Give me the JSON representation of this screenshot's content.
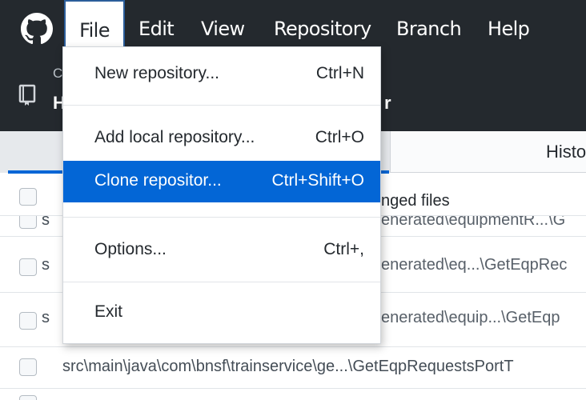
{
  "menubar": {
    "items": [
      "File",
      "Edit",
      "View",
      "Repository",
      "Branch",
      "Help"
    ]
  },
  "repo_bar": {
    "clip_1": "C",
    "clip_2": "H",
    "clip_3": "r"
  },
  "tabs": {
    "history": "Histo"
  },
  "file_list": {
    "header_right": "nged files",
    "rows": [
      {
        "left": "s",
        "right": "enerated\\equipmentR...\\G"
      },
      {
        "left": "s",
        "right": "enerated\\eq...\\GetEqpRec"
      },
      {
        "left": "s",
        "right": "enerated\\equip...\\GetEqp"
      },
      {
        "left": "src\\main\\java\\com\\bnsf\\trainservice\\ge...\\GetEqpRequestsPortT",
        "right": ""
      }
    ]
  },
  "file_menu": {
    "items": [
      {
        "label": "New repository...",
        "shortcut": "Ctrl+N"
      },
      {
        "label": "Add local repository...",
        "shortcut": "Ctrl+O"
      },
      {
        "label": "Clone repositor...",
        "shortcut": "Ctrl+Shift+O"
      },
      {
        "label": "Options...",
        "shortcut": "Ctrl+,"
      },
      {
        "label": "Exit",
        "shortcut": ""
      }
    ]
  },
  "colors": {
    "menubar_bg": "#24292e",
    "highlight": "#0366d6",
    "tab_underline": "#0366d6"
  },
  "icons": {
    "app_logo": "github-octocat-icon",
    "repo": "repo-book-icon"
  }
}
